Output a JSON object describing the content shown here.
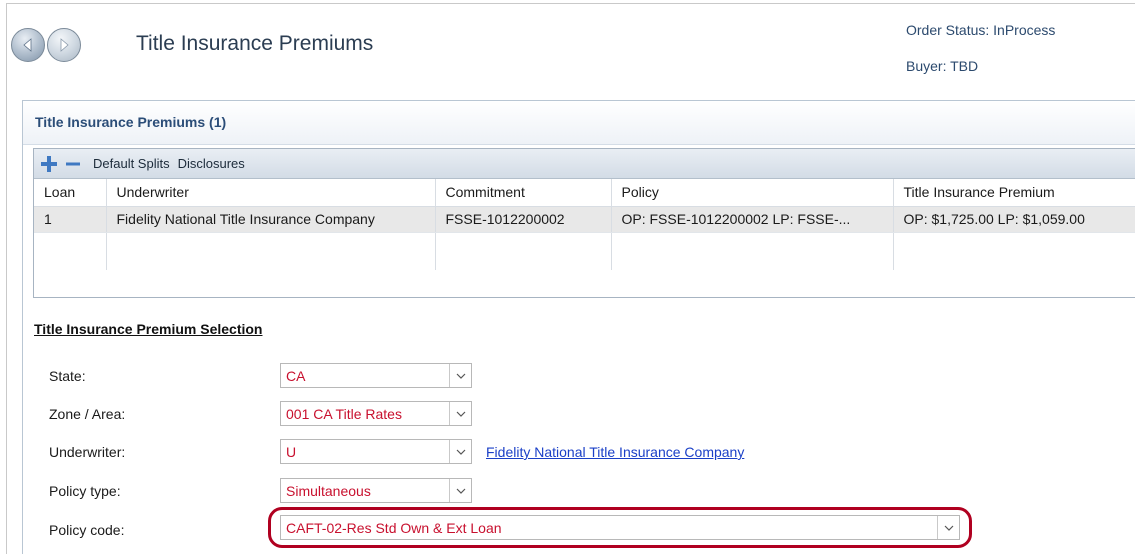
{
  "header": {
    "title": "Title Insurance Premiums",
    "order_status": "Order Status: InProcess",
    "buyer": "Buyer: TBD"
  },
  "panel": {
    "title": "Title Insurance Premiums (1)"
  },
  "toolbar": {
    "add_icon": "plus-icon",
    "remove_icon": "minus-icon",
    "default_splits": "Default Splits",
    "disclosures": "Disclosures"
  },
  "table": {
    "columns": [
      "Loan",
      "Underwriter",
      "Commitment",
      "Policy",
      "Title Insurance Premium"
    ],
    "rows": [
      [
        "1",
        "Fidelity National Title Insurance Company",
        "FSSE-1012200002",
        "OP: FSSE-1012200002 LP: FSSE-...",
        "OP: $1,725.00 LP: $1,059.00"
      ]
    ]
  },
  "selection": {
    "title": "Title Insurance Premium Selection",
    "state": {
      "label": "State:",
      "value": "CA"
    },
    "zone": {
      "label": "Zone / Area:",
      "value": "001 CA Title Rates"
    },
    "underwriter": {
      "label": "Underwriter:",
      "value": "U",
      "link": "Fidelity National Title Insurance Company"
    },
    "policy_type": {
      "label": "Policy type:",
      "value": "Simultaneous"
    },
    "policy_code": {
      "label": "Policy code:",
      "value": "CAFT-02-Res Std Own & Ext Loan"
    }
  },
  "colors": {
    "accent": "#2b4d78",
    "value_text": "#c8102e",
    "highlight": "#b00020",
    "link": "#1a3fc7"
  }
}
